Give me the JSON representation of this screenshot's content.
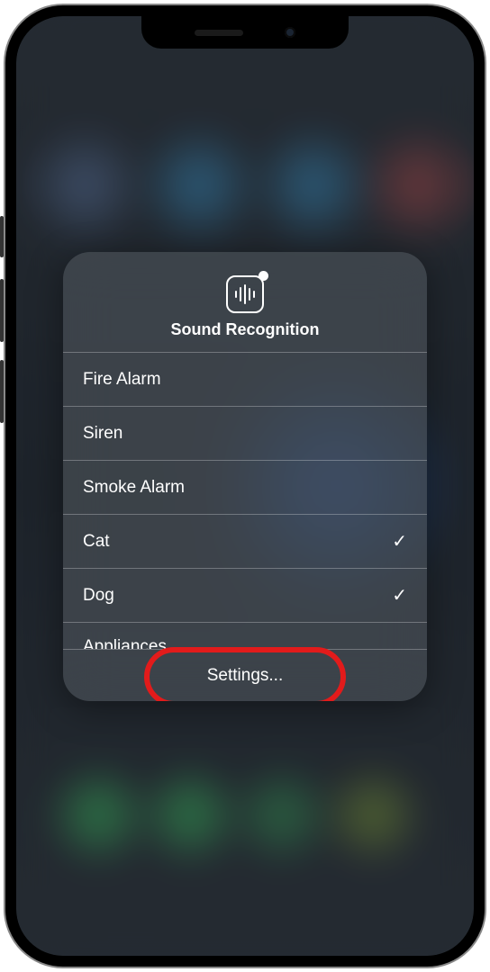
{
  "panel": {
    "title": "Sound Recognition",
    "items": [
      {
        "label": "Fire Alarm",
        "checked": false
      },
      {
        "label": "Siren",
        "checked": false
      },
      {
        "label": "Smoke Alarm",
        "checked": false
      },
      {
        "label": "Cat",
        "checked": true
      },
      {
        "label": "Dog",
        "checked": true
      },
      {
        "label": "Appliances",
        "checked": false
      }
    ],
    "footer_button": "Settings..."
  },
  "annotation": {
    "highlight_target": "settings-button"
  }
}
